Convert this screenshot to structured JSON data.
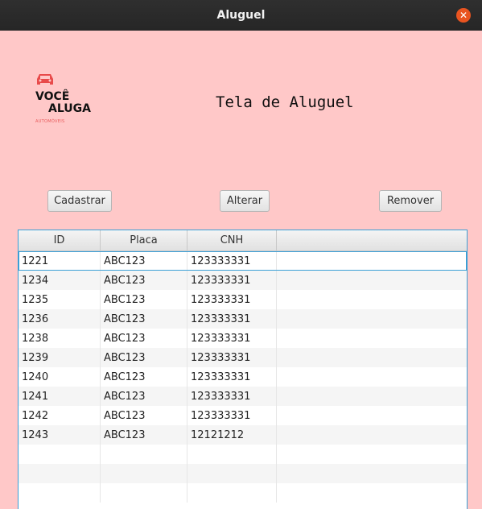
{
  "window": {
    "title": "Aluguel"
  },
  "logo": {
    "line1": "VOCÊ",
    "line2": "ALUGA",
    "sub": "AUTOMÓVEIS",
    "accent": "#e84a4a"
  },
  "screen": {
    "title": "Tela de Aluguel"
  },
  "buttons": {
    "cadastrar": "Cadastrar",
    "alterar": "Alterar",
    "remover": "Remover"
  },
  "table": {
    "columns": [
      "ID",
      "Placa",
      "CNH",
      ""
    ],
    "rows": [
      [
        "1221",
        "ABC123",
        "123333331"
      ],
      [
        "1234",
        "ABC123",
        "123333331"
      ],
      [
        "1235",
        "ABC123",
        "123333331"
      ],
      [
        "1236",
        "ABC123",
        "123333331"
      ],
      [
        "1238",
        "ABC123",
        "123333331"
      ],
      [
        "1239",
        "ABC123",
        "123333331"
      ],
      [
        "1240",
        "ABC123",
        "123333331"
      ],
      [
        "1241",
        "ABC123",
        "123333331"
      ],
      [
        "1242",
        "ABC123",
        "123333331"
      ],
      [
        "1243",
        "ABC123",
        "12121212"
      ]
    ],
    "empty_rows": 3,
    "selected_row": 0
  },
  "colors": {
    "background": "#ffc8c8",
    "titlebar": "#2b2b2b",
    "close": "#e95420",
    "selection": "#3b9fd6"
  }
}
